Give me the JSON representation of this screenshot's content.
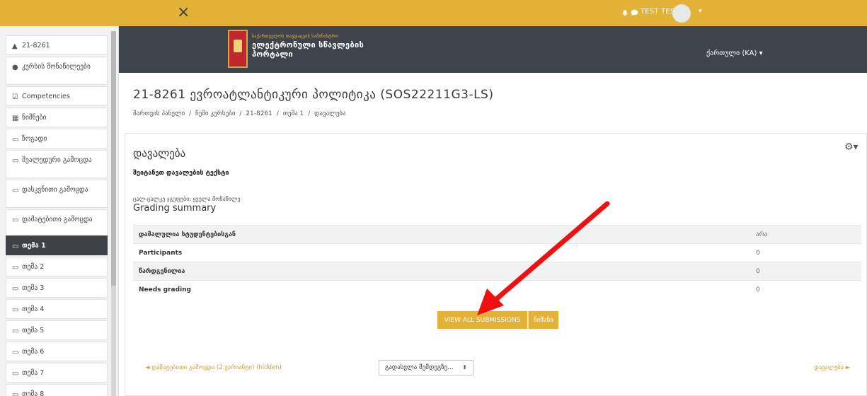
{
  "topbar": {
    "close_icon": "×",
    "user_name": "TEST TEST",
    "caret": "▾",
    "accent_color": "#e2b136"
  },
  "sidebar": {
    "items": [
      {
        "icon": "graduation-cap-icon",
        "glyph": "🎓",
        "label": "21-8261"
      },
      {
        "icon": "users-icon",
        "glyph": "👥",
        "label": "კურსის მონაწილეები"
      },
      {
        "icon": "checkbox-icon",
        "glyph": "☑",
        "label": "Competencies"
      },
      {
        "icon": "table-icon",
        "glyph": "▦",
        "label": "ნიშნები"
      },
      {
        "icon": "folder-icon",
        "glyph": "▭",
        "label": "ზოგადი"
      },
      {
        "icon": "folder-icon",
        "glyph": "▭",
        "label": "შუალედური გამოცდა"
      },
      {
        "icon": "folder-icon",
        "glyph": "▭",
        "label": "დასკვნითი გამოცდა"
      },
      {
        "icon": "folder-icon",
        "glyph": "▭",
        "label": "დამატებითი გამოცდა"
      },
      {
        "icon": "folder-icon",
        "glyph": "▭",
        "label": "თემა 1"
      },
      {
        "icon": "folder-icon",
        "glyph": "▭",
        "label": "თემა 2"
      },
      {
        "icon": "folder-icon",
        "glyph": "▭",
        "label": "თემა 3"
      },
      {
        "icon": "folder-icon",
        "glyph": "▭",
        "label": "თემა 4"
      },
      {
        "icon": "folder-icon",
        "glyph": "▭",
        "label": "თემა 5"
      },
      {
        "icon": "folder-icon",
        "glyph": "▭",
        "label": "თემა 6"
      },
      {
        "icon": "folder-icon",
        "glyph": "▭",
        "label": "თემა 7"
      },
      {
        "icon": "folder-icon",
        "glyph": "▭",
        "label": "თემა 8"
      }
    ]
  },
  "banner": {
    "small_text": "საქართველოს თავდაცვის სამინისტრო",
    "line1": "ელექტრონული სწავლების",
    "line2": "პორტალი",
    "language": "ქართული (KA) ▾"
  },
  "page": {
    "course_title": "21-8261 ევროატლანტიკური პოლიტიკა (SOS22211G3-LS)",
    "breadcrumb": [
      "მართვის პანელი",
      "/",
      "ჩემი კურსები",
      "/",
      "21-8261",
      "/",
      "თემა 1",
      "/",
      "დავალება"
    ]
  },
  "assignment": {
    "title": "დავალება",
    "description": "შეიტანეთ დავალების ტექსტი",
    "group_note": "ცალ-ცალკე ჯგუფები: ყველა მონაწილე",
    "summary_heading": "Grading summary",
    "rows": [
      {
        "label": "დამალულია სტუდენტებისგან",
        "value": "არა"
      },
      {
        "label": "Participants",
        "value": "0"
      },
      {
        "label": "წარდგენილია",
        "value": "0"
      },
      {
        "label": "Needs grading",
        "value": "0"
      }
    ],
    "view_all_button": "VIEW ALL SUBMISSIONS",
    "grade_button": "ნიშანი"
  },
  "navigation": {
    "prev_link": "◄ დამატებითი გამოცდა (2 ვარიანტი) (hidden)",
    "jump_select": "გადასვლა შემდეგზე...",
    "next_link": "დავალება ►"
  }
}
